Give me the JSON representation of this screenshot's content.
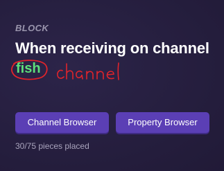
{
  "block": {
    "type_label": "BLOCK",
    "title": "When receiving on channel",
    "channel_value": "fish",
    "annotation_text": "channel"
  },
  "buttons": {
    "channel_browser": "Channel Browser",
    "property_browser": "Property Browser"
  },
  "progress": {
    "text": "30/75 pieces placed",
    "placed": 30,
    "total": 75
  },
  "colors": {
    "background": "#261f40",
    "accent": "#5b3fb5",
    "channel_value": "#5ee07a",
    "annotation": "#e0242b"
  }
}
